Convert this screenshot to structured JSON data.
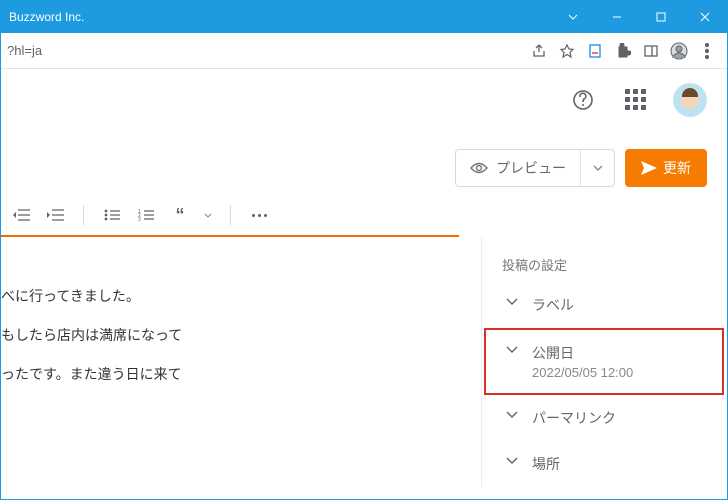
{
  "window": {
    "title": "Buzzword Inc."
  },
  "address": {
    "url": "?hl=ja"
  },
  "actions": {
    "preview_label": "プレビュー",
    "update_label": "更新"
  },
  "sidebar": {
    "title": "投稿の設定",
    "items": [
      {
        "label": "ラベル"
      },
      {
        "label": "公開日",
        "value": "2022/05/05 12:00"
      },
      {
        "label": "パーマリンク"
      },
      {
        "label": "場所"
      }
    ]
  },
  "editor": {
    "lines": [
      "べに行ってきました。",
      "もしたら店内は満席になって",
      "ったです。また違う日に来て"
    ]
  }
}
